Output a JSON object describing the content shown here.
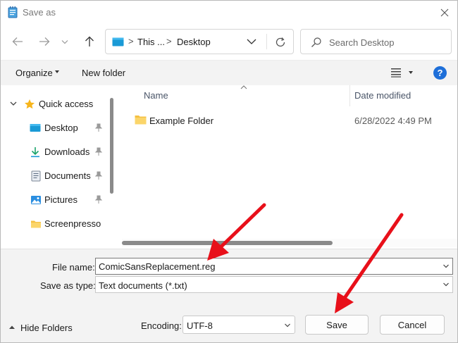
{
  "window": {
    "title": "Save as",
    "icon": "notepad-icon"
  },
  "nav": {
    "back_icon": "arrow-left-icon",
    "forward_icon": "arrow-right-icon",
    "recent_icon": "chevron-down-icon",
    "up_icon": "arrow-up-icon"
  },
  "address": {
    "segments": [
      "This ...",
      "Desktop"
    ],
    "separator": ">"
  },
  "search": {
    "placeholder": "Search Desktop"
  },
  "toolbar": {
    "organize_label": "Organize",
    "new_folder_label": "New folder",
    "help_label": "?"
  },
  "sidebar": {
    "items": [
      {
        "label": "Quick access",
        "icon": "star-icon",
        "pinned": false
      },
      {
        "label": "Desktop",
        "icon": "desktop-icon",
        "pinned": true
      },
      {
        "label": "Downloads",
        "icon": "download-icon",
        "pinned": true
      },
      {
        "label": "Documents",
        "icon": "document-icon",
        "pinned": true
      },
      {
        "label": "Pictures",
        "icon": "pictures-icon",
        "pinned": true
      },
      {
        "label": "Screenpresso",
        "icon": "folder-icon",
        "pinned": false
      }
    ]
  },
  "content": {
    "columns": {
      "name": "Name",
      "date": "Date modified"
    },
    "rows": [
      {
        "name": "Example Folder",
        "date": "6/28/2022 4:49 PM",
        "icon": "folder-icon"
      }
    ]
  },
  "form": {
    "file_name_label": "File name:",
    "file_name_value": "ComicSansReplacement.reg",
    "save_type_label": "Save as type:",
    "save_type_value": "Text documents (*.txt)",
    "encoding_label": "Encoding:",
    "encoding_value": "UTF-8"
  },
  "footer": {
    "hide_folders_label": "Hide Folders",
    "save_label": "Save",
    "cancel_label": "Cancel"
  },
  "colors": {
    "accent": "#1e6fd9",
    "annotation_arrow": "#e8101a",
    "toolbar_bg": "#f3f3f3",
    "folder": "#f5c042"
  }
}
